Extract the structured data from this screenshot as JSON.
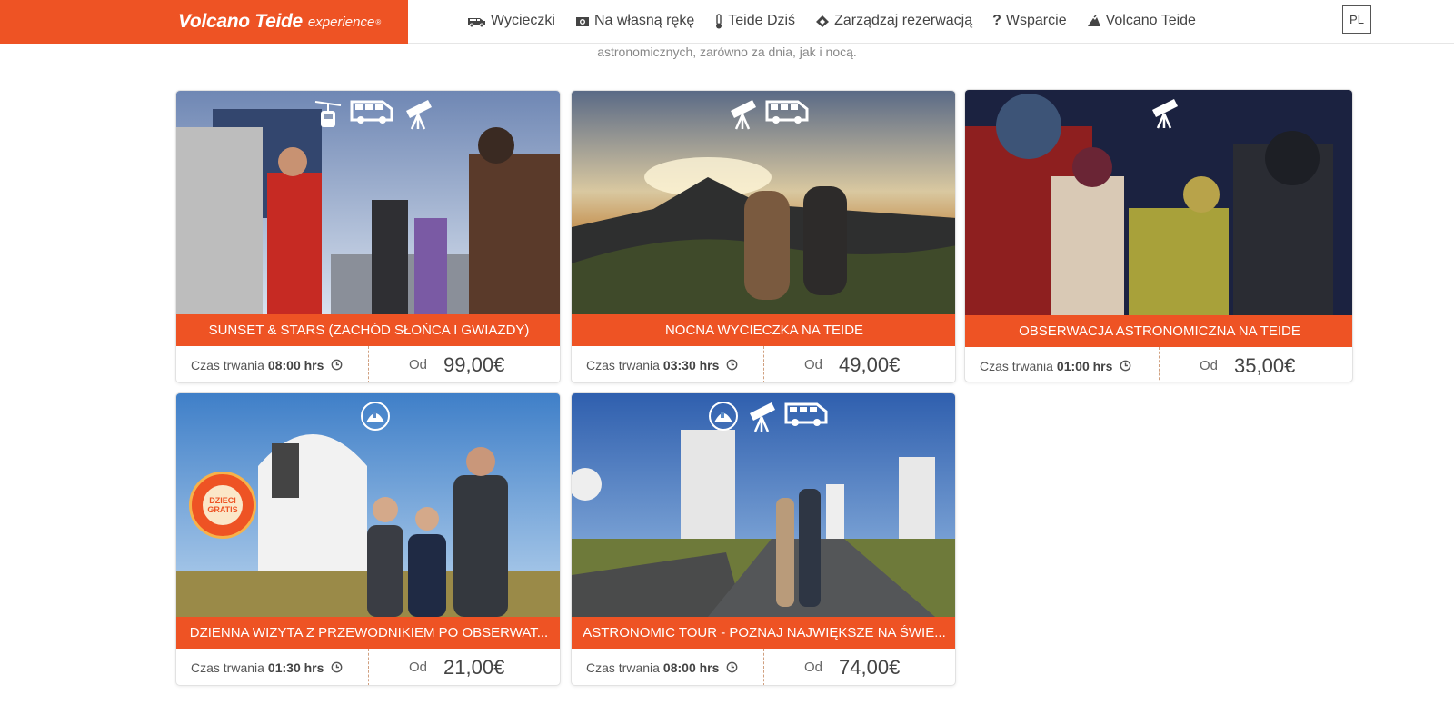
{
  "header": {
    "brand": "Volcano Teide",
    "brand_suffix": "experience",
    "reg_mark": "®",
    "nav": [
      {
        "label": "Wycieczki",
        "icon": "van-icon"
      },
      {
        "label": "Na własną rękę",
        "icon": "camera-icon"
      },
      {
        "label": "Teide Dziś",
        "icon": "thermometer-icon"
      },
      {
        "label": "Zarządzaj rezerwacją",
        "icon": "ticket-icon"
      },
      {
        "label": "Wsparcie",
        "icon": "question-icon"
      },
      {
        "label": "Volcano Teide",
        "icon": "volcano-icon"
      }
    ],
    "language": "PL"
  },
  "intro_text": "astronomicznych, zarówno za dnia, jak i nocą.",
  "colors": {
    "accent": "#ee5324",
    "text": "#444444"
  },
  "duration_label": "Czas trwania",
  "price_label": "Od",
  "cards": [
    {
      "title": "SUNSET & STARS (ZACHÓD SŁOŃCA I GWIAZDY)",
      "duration": "08:00 hrs",
      "price": "99,00€",
      "icons": [
        "cable-car-icon",
        "van-icon",
        "telescope-icon"
      ]
    },
    {
      "title": "NOCNA WYCIECZKA NA TEIDE",
      "duration": "03:30 hrs",
      "price": "49,00€",
      "icons": [
        "telescope-icon",
        "van-icon"
      ]
    },
    {
      "title": "OBSERWACJA ASTRONOMICZNA NA TEIDE",
      "duration": "01:00 hrs",
      "price": "35,00€",
      "icons": [
        "telescope-icon"
      ]
    },
    {
      "title": "DZIENNA WIZYTA Z PRZEWODNIKIEM PO OBSERWAT...",
      "duration": "01:30 hrs",
      "price": "21,00€",
      "icons": [
        "observatory-icon"
      ],
      "badge": "DZIECI GRATIS"
    },
    {
      "title": "ASTRONOMIC TOUR - POZNAJ NAJWIĘKSZE NA ŚWIE...",
      "duration": "08:00 hrs",
      "price": "74,00€",
      "icons": [
        "observatory-icon",
        "telescope-icon",
        "van-icon"
      ]
    }
  ]
}
